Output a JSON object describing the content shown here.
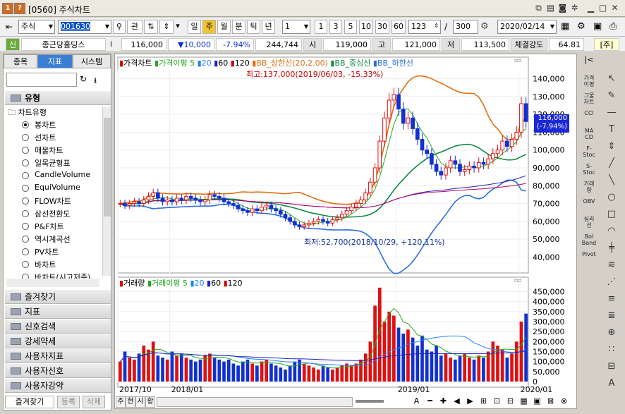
{
  "window": {
    "badge1": "1",
    "badge2": "?",
    "title": "[0560] 주식차트"
  },
  "toolbar": {
    "market": "주식",
    "code": "001630",
    "btn_gwan": "관",
    "periods": [
      "일",
      "주",
      "월",
      "분",
      "틱",
      "년"
    ],
    "period_active": "주",
    "interval": "1",
    "minutes": [
      "1",
      "3",
      "5",
      "10",
      "30",
      "60"
    ],
    "count": "123",
    "slash": "/",
    "total": "300",
    "date": "2020/02/14"
  },
  "info": {
    "tag": "신",
    "name": "종근당홀딩스",
    "i": "i",
    "price": "116,000",
    "change": "▼10,000",
    "rate": "-7.94%",
    "volume": "244,744",
    "label_open": "시",
    "open": "119,000",
    "label_high": "고",
    "high": "121,000",
    "label_low": "저",
    "low": "113,500",
    "label_strength": "체결강도",
    "strength": "64.81",
    "unit": "[주]"
  },
  "left": {
    "tabs": [
      "종목",
      "지표",
      "시스템"
    ],
    "active_tab": "지표",
    "section": "유형",
    "tree_root": "차트유형",
    "items": [
      "봉차트",
      "선차트",
      "매물차트",
      "일목균형표",
      "CandleVolume",
      "EquiVolume",
      "FLOW차트",
      "삼선전환도",
      "P&F차트",
      "역시계곡선",
      "PV차트",
      "바차트",
      "바차트(시고저종)"
    ],
    "selected": "봉차트",
    "folders": [
      "즐겨찾기",
      "지표",
      "신호검색",
      "강세약세",
      "사용자지표",
      "사용자신호",
      "사용자강약"
    ],
    "bottom_tabs": [
      "즐겨찾기",
      "등록",
      "삭제"
    ]
  },
  "price_legend": {
    "title": "가격차트",
    "ma": "가격이평 5",
    "ma20": "20",
    "ma60": "60",
    "ma120": "120",
    "bb_upper": "BB_상한선(20,2.00)",
    "bb_mid": "BB_중심선",
    "bb_lower": "BB_하한선"
  },
  "price_axis": [
    "140,000",
    "130,000",
    "120,000",
    "110,000",
    "100,000",
    "90,000",
    "80,000",
    "70,000",
    "60,000",
    "50,000",
    "40,000"
  ],
  "current_box": [
    "116,000",
    "(-7.94%)"
  ],
  "annot_high": "최고:137,000(2019/06/03, -15.33%)",
  "annot_low": "최저:52,700(2018/10/29, +120.11%)",
  "vol_legend": {
    "title": "거래량",
    "ma": "거래이평 5",
    "ma20": "20",
    "ma60": "60",
    "ma120": "120"
  },
  "vol_axis": [
    "450,000",
    "400,000",
    "350,000",
    "300,000",
    "250,000",
    "200,000",
    "150,000",
    "100,000",
    "50,000",
    "0"
  ],
  "x_axis": [
    "2017/10",
    "2018/01",
    "2019/01",
    "2020/01"
  ],
  "chart_data": {
    "type": "candlestick",
    "unit": "weekly",
    "ylim": [
      35000,
      145000
    ],
    "vol_ylim": [
      0,
      480000
    ],
    "close": [
      70000,
      69000,
      70000,
      71000,
      70000,
      72000,
      74000,
      76000,
      73000,
      71000,
      72000,
      71000,
      73000,
      72000,
      74000,
      73000,
      72000,
      71000,
      72000,
      75000,
      74000,
      73000,
      71000,
      70000,
      69000,
      67000,
      66000,
      65000,
      67000,
      66000,
      68000,
      69000,
      67000,
      66000,
      64000,
      62000,
      60000,
      58000,
      57000,
      58000,
      59000,
      60000,
      61000,
      60000,
      59000,
      61000,
      62000,
      64000,
      66000,
      68000,
      70000,
      72000,
      76000,
      82000,
      90000,
      105000,
      118000,
      128000,
      131000,
      123000,
      115000,
      118000,
      112000,
      106000,
      100000,
      98000,
      92000,
      88000,
      86000,
      90000,
      94000,
      92000,
      88000,
      89000,
      91000,
      90000,
      93000,
      92000,
      95000,
      98000,
      100000,
      105000,
      102000,
      106000,
      110000,
      126000,
      116000
    ],
    "volume": [
      100000,
      150000,
      120000,
      110000,
      140000,
      180000,
      160000,
      200000,
      130000,
      120000,
      110000,
      150000,
      130000,
      140000,
      120000,
      110000,
      100000,
      110000,
      130000,
      140000,
      120000,
      110000,
      100000,
      110000,
      90000,
      80000,
      100000,
      110000,
      90000,
      80000,
      100000,
      110000,
      90000,
      80000,
      70000,
      60000,
      80000,
      100000,
      110000,
      90000,
      80000,
      70000,
      60000,
      80000,
      70000,
      60000,
      70000,
      80000,
      90000,
      80000,
      90000,
      110000,
      140000,
      200000,
      380000,
      470000,
      300000,
      350000,
      330000,
      270000,
      240000,
      260000,
      220000,
      180000,
      230000,
      160000,
      150000,
      180000,
      130000,
      140000,
      120000,
      110000,
      130000,
      140000,
      120000,
      110000,
      130000,
      120000,
      150000,
      200000,
      180000,
      160000,
      120000,
      140000,
      200000,
      300000,
      340000
    ]
  }
}
